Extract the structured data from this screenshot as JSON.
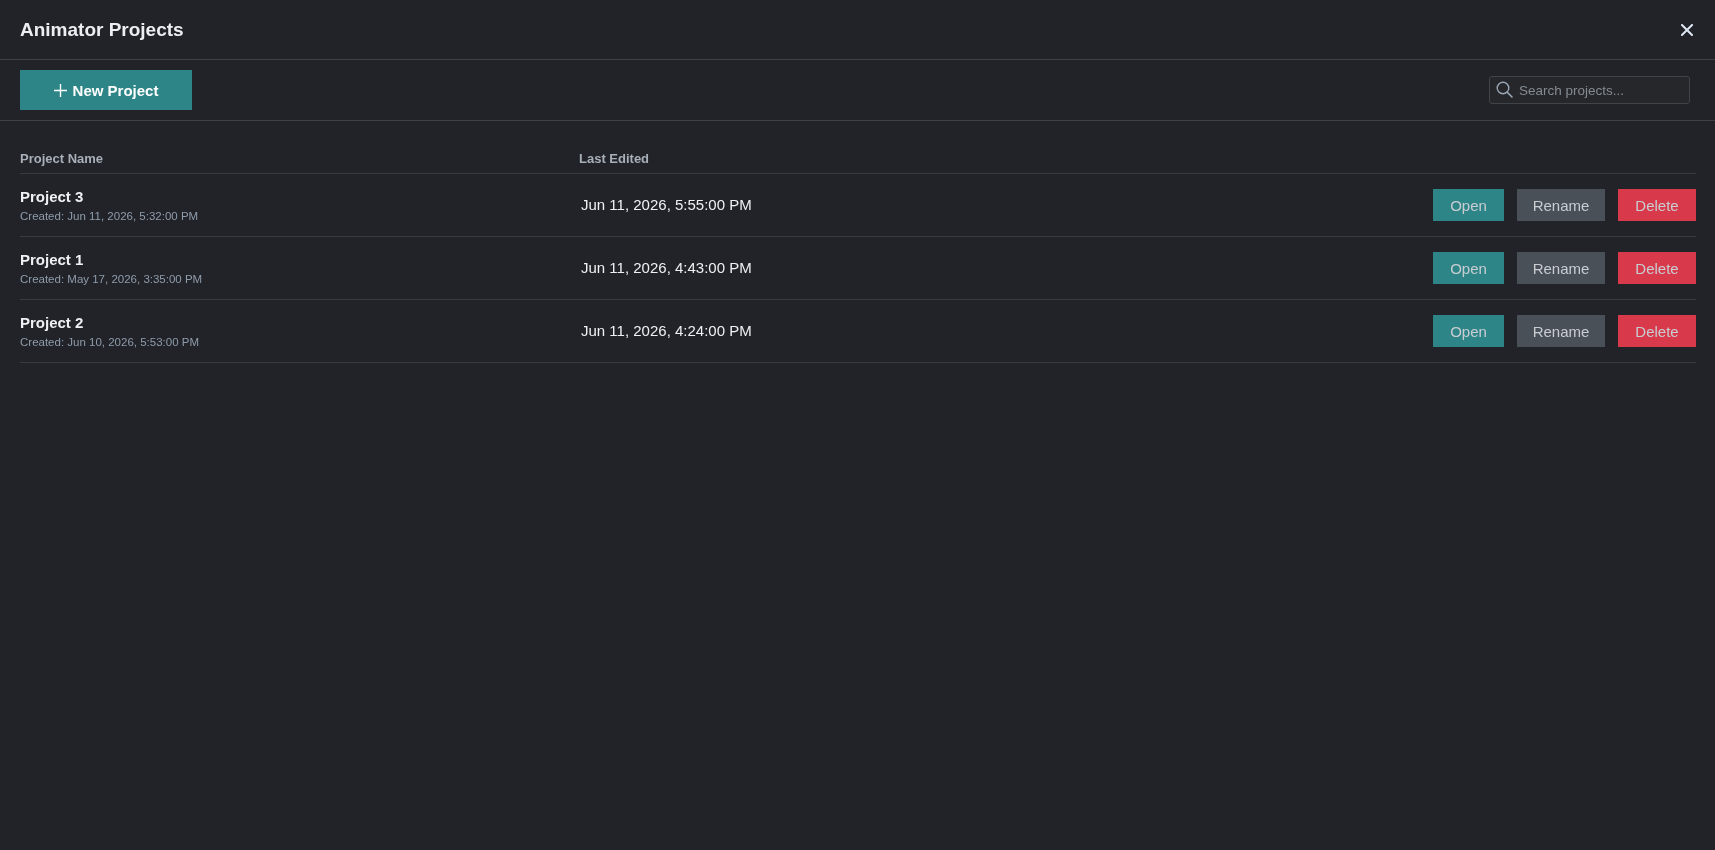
{
  "window": {
    "title": "Animator Projects"
  },
  "toolbar": {
    "new_project_button": {
      "label": "New Project"
    },
    "search": {
      "placeholder": "Search projects..."
    }
  },
  "table": {
    "columns": [
      "Project Name",
      "Last Edited"
    ],
    "rows": [
      {
        "name": "Project 3",
        "created": "Created: Jun 11, 2026, 5:32:00 PM",
        "last_edited": "Jun 11, 2026, 5:55:00 PM",
        "actions": [
          {
            "kind": "open",
            "label": "Open"
          },
          {
            "kind": "rename",
            "label": "Rename"
          },
          {
            "kind": "delete",
            "label": "Delete"
          }
        ]
      },
      {
        "name": "Project 1",
        "created": "Created: May 17, 2026, 3:35:00 PM",
        "last_edited": "Jun 11, 2026, 4:43:00 PM",
        "actions": [
          {
            "kind": "open",
            "label": "Open"
          },
          {
            "kind": "rename",
            "label": "Rename"
          },
          {
            "kind": "delete",
            "label": "Delete"
          }
        ]
      },
      {
        "name": "Project 2",
        "created": "Created: Jun 10, 2026, 5:53:00 PM",
        "last_edited": "Jun 11, 2026, 4:24:00 PM",
        "actions": [
          {
            "kind": "open",
            "label": "Open"
          },
          {
            "kind": "rename",
            "label": "Rename"
          },
          {
            "kind": "delete",
            "label": "Delete"
          }
        ]
      }
    ]
  }
}
